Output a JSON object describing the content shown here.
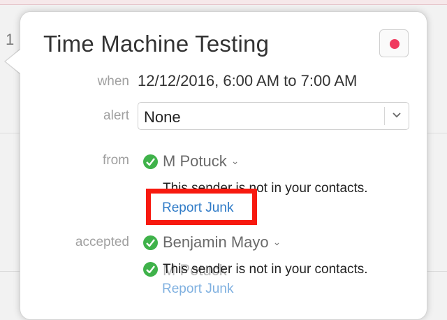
{
  "background": {
    "glyph": "1"
  },
  "event": {
    "title": "Time Machine Testing",
    "color": "#f03a5f"
  },
  "labels": {
    "when": "when",
    "alert": "alert",
    "from": "from",
    "accepted": "accepted"
  },
  "when_value": "12/12/2016, 6:00 AM to 7:00 AM",
  "alert": {
    "selected": "None"
  },
  "from": {
    "name": "M Potuck",
    "note": "This sender is not in your contacts.",
    "link": "Report Junk"
  },
  "accepted": {
    "name": "Benjamin Mayo",
    "overlap_name": "M Potuck",
    "note": "This sender is not in your contacts.",
    "overlap_link": "Report Junk"
  },
  "colors": {
    "check": "#3fb24a",
    "link": "#2f7bc7",
    "highlight": "#f7190f"
  },
  "icons": {
    "check": "check-circle-icon",
    "chevron": "chevron-down-icon"
  }
}
